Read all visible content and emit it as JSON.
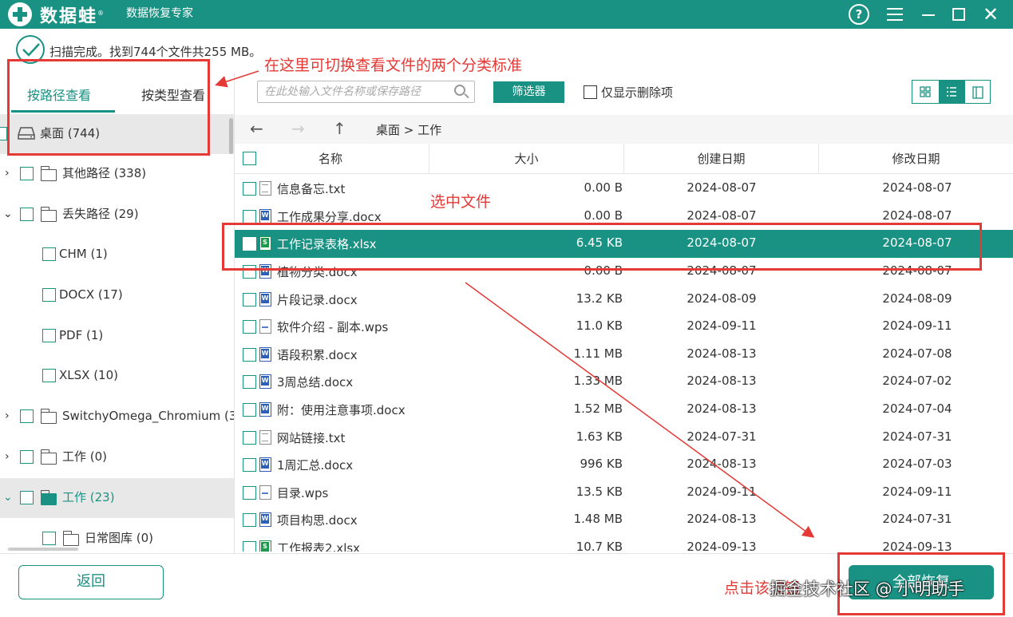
{
  "app": {
    "name": "数据蛙",
    "trademark": "®",
    "subtitle": "数据恢复专家",
    "help_glyph": "?",
    "close_glyph": "✕"
  },
  "scan_status": "扫描完成。找到744个文件共255 MB。",
  "tabs": [
    {
      "label": "按路径查看",
      "active": true
    },
    {
      "label": "按类型查看",
      "active": false
    }
  ],
  "tree": [
    {
      "label": "桌面 (744)",
      "icon": "drive-icon",
      "selected": true
    },
    {
      "label": "其他路径 (338)",
      "icon": "folder-icon",
      "expander": "›"
    },
    {
      "label": "丢失路径 (29)",
      "icon": "folder-icon",
      "expander": "⌄"
    },
    {
      "label": "CHM (1)"
    },
    {
      "label": "DOCX (17)"
    },
    {
      "label": "PDF (1)"
    },
    {
      "label": "XLSX (10)"
    },
    {
      "label": "SwitchyOmega_Chromium (3",
      "icon": "folder-icon",
      "expander": "›"
    },
    {
      "label": "工作 (0)",
      "icon": "folder-icon",
      "expander": "›"
    },
    {
      "label": "工作 (23)",
      "icon": "folder-icon",
      "expander": "⌄",
      "highlighted": true
    },
    {
      "label": "日常图库 (0)",
      "icon": "folder-icon"
    }
  ],
  "toolbar": {
    "search_placeholder": "在此处输入文件名称或保存路径",
    "filter_label": "筛选器",
    "only_deleted_label": "仅显示删除项",
    "views": [
      "grid-view",
      "list-view",
      "detail-view"
    ],
    "active_view": "list-view"
  },
  "nav": {
    "back": "←",
    "forward": "→",
    "up": "↑",
    "breadcrumb": "桌面 > 工作"
  },
  "table": {
    "headers": [
      "名称",
      "大小",
      "创建日期",
      "修改日期"
    ],
    "rows": [
      {
        "name": "信息备忘.txt",
        "size": "0.00  B",
        "created": "2024-08-07",
        "modified": "2024-08-07",
        "type": "txt"
      },
      {
        "name": "工作成果分享.docx",
        "size": "0.00  B",
        "created": "2024-08-07",
        "modified": "2024-08-07",
        "type": "docx"
      },
      {
        "name": "工作记录表格.xlsx",
        "size": "6.45 KB",
        "created": "2024-08-07",
        "modified": "2024-08-07",
        "type": "xlsx",
        "selected": true
      },
      {
        "name": "植物分类.docx",
        "size": "0.00  B",
        "created": "2024-08-07",
        "modified": "2024-08-07",
        "type": "docx"
      },
      {
        "name": "片段记录.docx",
        "size": "13.2 KB",
        "created": "2024-08-09",
        "modified": "2024-08-09",
        "type": "docx"
      },
      {
        "name": "软件介绍 - 副本.wps",
        "size": "11.0 KB",
        "created": "2024-09-11",
        "modified": "2024-09-11",
        "type": "wps"
      },
      {
        "name": "语段积累.docx",
        "size": "1.11 MB",
        "created": "2024-08-13",
        "modified": "2024-07-08",
        "type": "docx"
      },
      {
        "name": "3周总结.docx",
        "size": "1.33 MB",
        "created": "2024-08-13",
        "modified": "2024-07-02",
        "type": "docx"
      },
      {
        "name": "附：使用注意事项.docx",
        "size": "1.52 MB",
        "created": "2024-08-13",
        "modified": "2024-07-04",
        "type": "docx"
      },
      {
        "name": "网站链接.txt",
        "size": "1.63 KB",
        "created": "2024-07-31",
        "modified": "2024-07-31",
        "type": "txt"
      },
      {
        "name": "1周汇总.docx",
        "size": "996 KB",
        "created": "2024-08-13",
        "modified": "2024-07-03",
        "type": "docx"
      },
      {
        "name": "目录.wps",
        "size": "13.5 KB",
        "created": "2024-09-11",
        "modified": "2024-09-11",
        "type": "wps"
      },
      {
        "name": "项目构思.docx",
        "size": "1.48 MB",
        "created": "2024-08-13",
        "modified": "2024-07-31",
        "type": "docx"
      },
      {
        "name": "工作报表2.xlsx",
        "size": "10.7 KB",
        "created": "2024-09-13",
        "modified": "2024-09-13",
        "type": "xlsx"
      }
    ]
  },
  "buttons": {
    "back": "返回",
    "recover_all": "全部恢复"
  },
  "annotations": {
    "switch_hint": "在这里可切换查看文件的两个分类标准",
    "select_file": "选中文件",
    "click_button": "点击该按钮",
    "color": "#e53935"
  },
  "watermark": "掘金技术社区 @ 小明助手",
  "colors": {
    "accent": "#1a9283",
    "selected_row": "#1a9283",
    "annotation": "#e53935"
  }
}
